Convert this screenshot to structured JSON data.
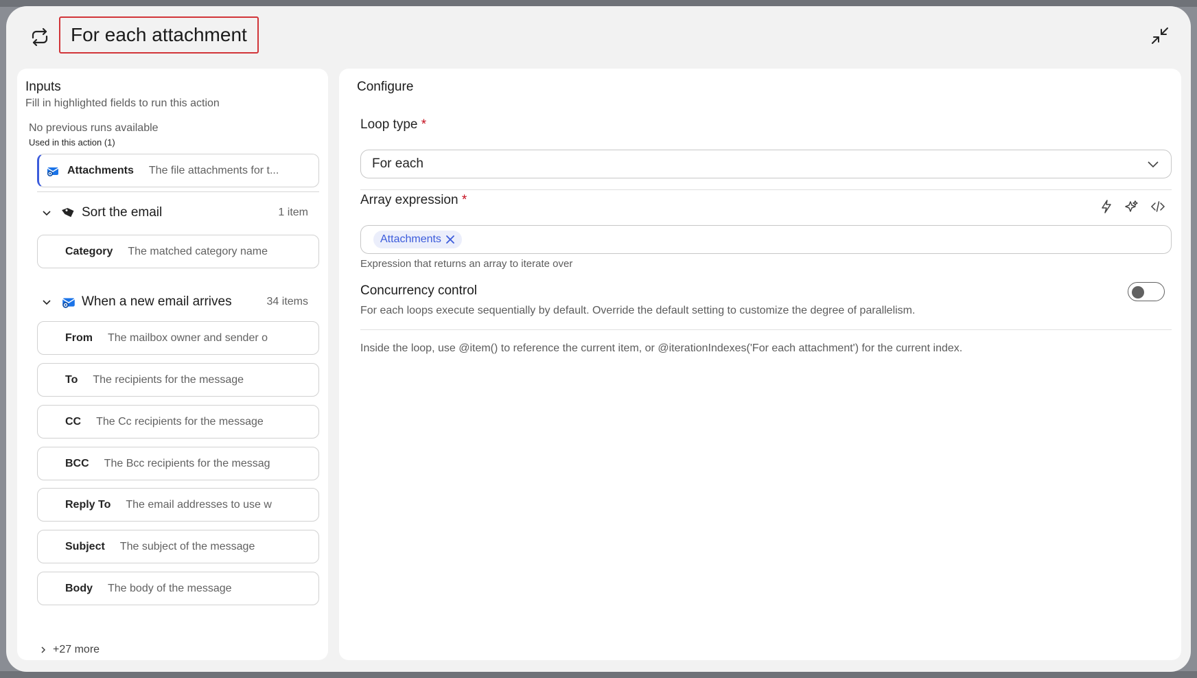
{
  "header": {
    "title": "For each attachment",
    "loop_icon": "loop-arrows-icon",
    "collapse_icon": "collapse-arrows-icon"
  },
  "inputs": {
    "title": "Inputs",
    "subtitle": "Fill in highlighted fields to run this action",
    "no_runs": "No previous runs available",
    "used_label": "Used in this action (1)",
    "used_items": [
      {
        "label": "Attachments",
        "description": "The file attachments for t..."
      }
    ],
    "groups": [
      {
        "title": "Sort the email",
        "count": "1 item",
        "icon": "tag-icon",
        "items": [
          {
            "label": "Category",
            "description": "The matched category name"
          }
        ]
      },
      {
        "title": "When a new email arrives",
        "count": "34 items",
        "icon": "outlook-mail-icon",
        "items": [
          {
            "label": "From",
            "description": "The mailbox owner and sender o"
          },
          {
            "label": "To",
            "description": "The recipients for the message"
          },
          {
            "label": "CC",
            "description": "The Cc recipients for the message"
          },
          {
            "label": "BCC",
            "description": "The Bcc recipients for the messag"
          },
          {
            "label": "Reply To",
            "description": "The email addresses to use w"
          },
          {
            "label": "Subject",
            "description": "The subject of the message"
          },
          {
            "label": "Body",
            "description": "The body of the message"
          }
        ]
      }
    ],
    "more": "+27 more"
  },
  "configure": {
    "title": "Configure",
    "loop_type_label": "Loop type",
    "required_mark": "*",
    "loop_type_value": "For each",
    "array_label": "Array expression",
    "array_token": "Attachments",
    "array_help": "Expression that returns an array to iterate over",
    "concurrency_title": "Concurrency control",
    "concurrency_desc": "For each loops execute sequentially by default. Override the default setting to customize the degree of parallelism.",
    "concurrency_enabled": false,
    "hint": "Inside the loop, use @item() to reference the current item, or @iterationIndexes('For each attachment') for the current index.",
    "tool_icons": [
      "lightning-icon",
      "sparkle-icon",
      "code-icon"
    ]
  },
  "colors": {
    "accent": "#3b5bdb",
    "required": "#c50f1f",
    "title_border": "#d13438"
  }
}
